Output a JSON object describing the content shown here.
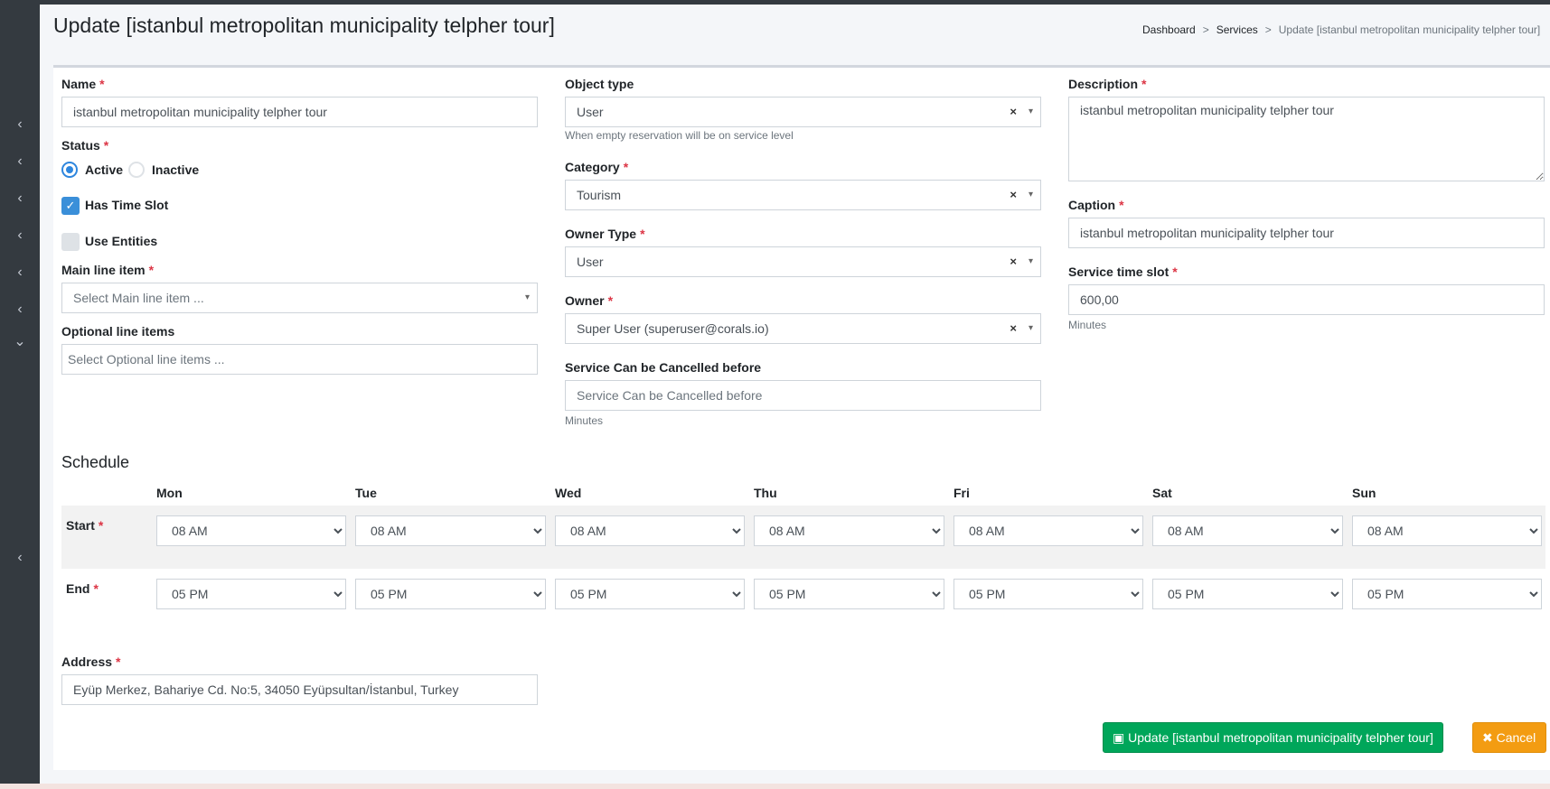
{
  "page": {
    "title": "Update [istanbul metropolitan municipality telpher tour]",
    "breadcrumb": [
      "Dashboard",
      "Services",
      "Update [istanbul metropolitan municipality telpher tour]"
    ]
  },
  "sidebar": {
    "chevrons": [
      "‹",
      "‹",
      "‹",
      "‹",
      "‹",
      "‹",
      "⌄",
      "‹"
    ]
  },
  "form": {
    "name": {
      "label": "Name",
      "value": "istanbul metropolitan municipality telpher tour"
    },
    "status": {
      "label": "Status",
      "options": [
        "Active",
        "Inactive"
      ],
      "selected": "Active"
    },
    "has_time_slot": {
      "label": "Has Time Slot",
      "checked": true
    },
    "use_entities": {
      "label": "Use Entities",
      "checked": false
    },
    "main_line_item": {
      "label": "Main line item",
      "placeholder": "Select Main line item ..."
    },
    "optional_line_items": {
      "label": "Optional line items",
      "placeholder": "Select Optional line items ..."
    },
    "object_type": {
      "label": "Object type",
      "value": "User",
      "help": "When empty reservation will be on service level"
    },
    "category": {
      "label": "Category",
      "value": "Tourism"
    },
    "owner_type": {
      "label": "Owner Type",
      "value": "User"
    },
    "owner": {
      "label": "Owner",
      "value": "Super User (superuser@corals.io)"
    },
    "cancel_before": {
      "label": "Service Can be Cancelled before",
      "placeholder": "Service Can be Cancelled before",
      "help": "Minutes"
    },
    "description": {
      "label": "Description",
      "value": "istanbul metropolitan municipality telpher tour"
    },
    "caption": {
      "label": "Caption",
      "value": "istanbul metropolitan municipality telpher tour"
    },
    "service_time_slot": {
      "label": "Service time slot",
      "value": "600,00",
      "help": "Minutes"
    },
    "address": {
      "label": "Address",
      "value": "Eyüp Merkez, Bahariye Cd. No:5, 34050 Eyüpsultan/İstanbul, Turkey"
    },
    "clear_symbol": "×",
    "caret_symbol": "▾",
    "required_mark": "*"
  },
  "schedule": {
    "title": "Schedule",
    "days": [
      "Mon",
      "Tue",
      "Wed",
      "Thu",
      "Fri",
      "Sat",
      "Sun"
    ],
    "start_label": "Start",
    "end_label": "End",
    "start_value": "08 AM",
    "end_value": "05 PM"
  },
  "buttons": {
    "update": "Update [istanbul metropolitan municipality telpher tour]",
    "cancel": "Cancel"
  },
  "colors": {
    "accent": "#2e86de",
    "update": "#00a65a",
    "cancel": "#f39c12",
    "required": "#dc3545",
    "sidebar": "#343a40"
  }
}
